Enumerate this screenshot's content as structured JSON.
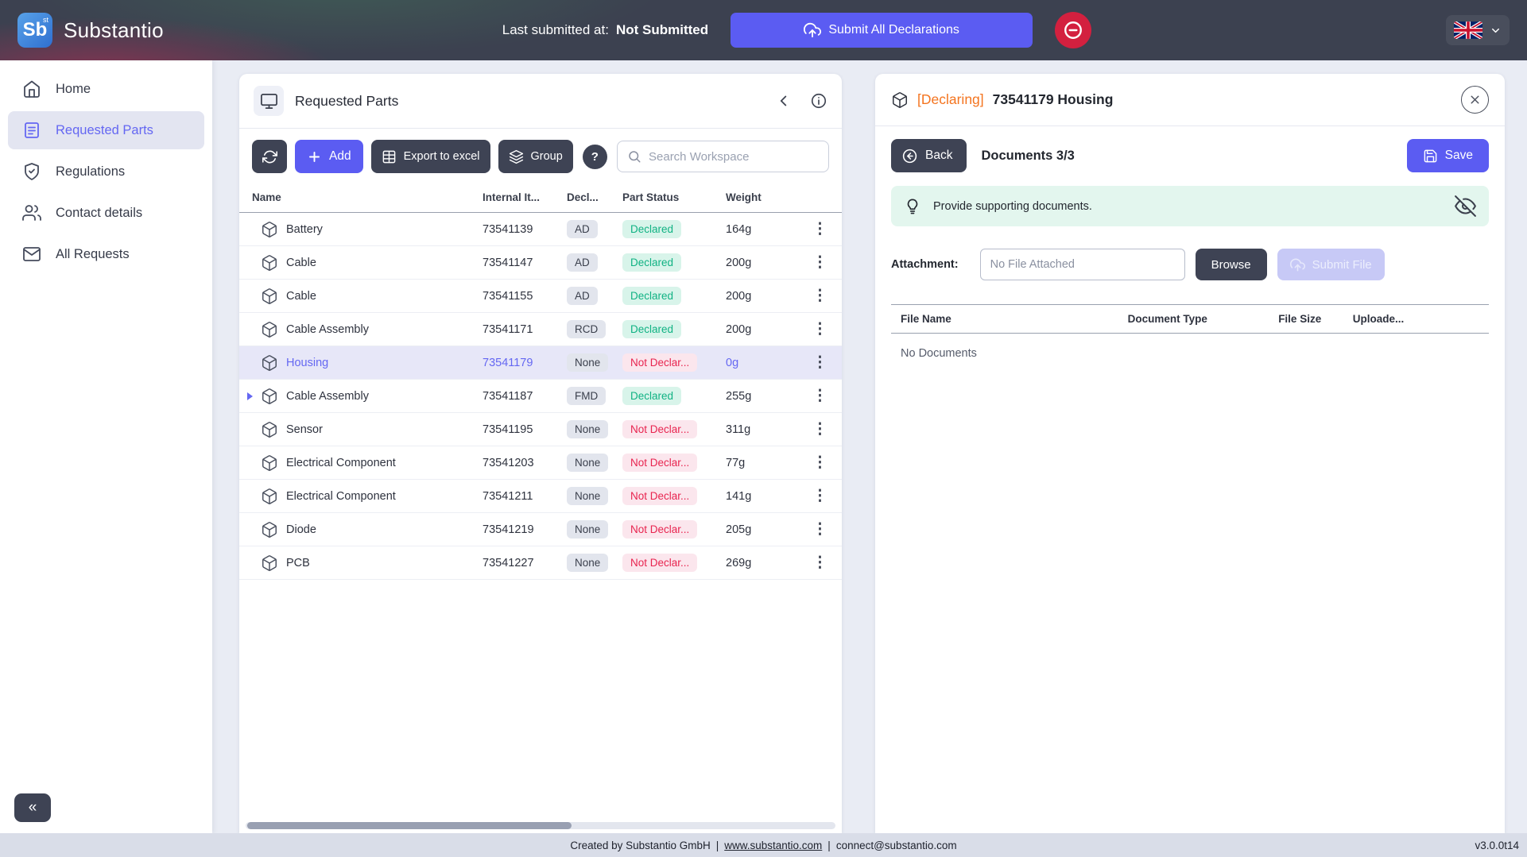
{
  "topbar": {
    "logo_text": "Sb",
    "logo_superscript": "st",
    "app_name": "Substantio",
    "last_submitted_label": "Last submitted at:",
    "last_submitted_value": "Not Submitted",
    "submit_all_label": "Submit All Declarations"
  },
  "sidebar": {
    "items": [
      {
        "label": "Home"
      },
      {
        "label": "Requested Parts"
      },
      {
        "label": "Regulations"
      },
      {
        "label": "Contact details"
      },
      {
        "label": "All Requests"
      }
    ],
    "collapse_label": "«"
  },
  "parts_panel": {
    "title": "Requested Parts",
    "toolbar": {
      "add_label": "Add",
      "export_label": "Export to excel",
      "group_label": "Group",
      "help_label": "?",
      "search_placeholder": "Search Workspace"
    },
    "table": {
      "columns": [
        "Name",
        "Internal It...",
        "Decl...",
        "Part Status",
        "Weight"
      ],
      "rows": [
        {
          "name": "Battery",
          "internal_item": "73541139",
          "decl": "AD",
          "status": "Declared",
          "status_type": "declared",
          "weight": "164g",
          "selected": false,
          "expandable": false
        },
        {
          "name": "Cable",
          "internal_item": "73541147",
          "decl": "AD",
          "status": "Declared",
          "status_type": "declared",
          "weight": "200g",
          "selected": false,
          "expandable": false
        },
        {
          "name": "Cable",
          "internal_item": "73541155",
          "decl": "AD",
          "status": "Declared",
          "status_type": "declared",
          "weight": "200g",
          "selected": false,
          "expandable": false
        },
        {
          "name": "Cable Assembly",
          "internal_item": "73541171",
          "decl": "RCD",
          "status": "Declared",
          "status_type": "declared",
          "weight": "200g",
          "selected": false,
          "expandable": false
        },
        {
          "name": "Housing",
          "internal_item": "73541179",
          "decl": "None",
          "status": "Not Declar...",
          "status_type": "not-declared",
          "weight": "0g",
          "selected": true,
          "expandable": false
        },
        {
          "name": "Cable Assembly",
          "internal_item": "73541187",
          "decl": "FMD",
          "status": "Declared",
          "status_type": "declared",
          "weight": "255g",
          "selected": false,
          "expandable": true
        },
        {
          "name": "Sensor",
          "internal_item": "73541195",
          "decl": "None",
          "status": "Not Declar...",
          "status_type": "not-declared",
          "weight": "311g",
          "selected": false,
          "expandable": false
        },
        {
          "name": "Electrical Component",
          "internal_item": "73541203",
          "decl": "None",
          "status": "Not Declar...",
          "status_type": "not-declared",
          "weight": "77g",
          "selected": false,
          "expandable": false
        },
        {
          "name": "Electrical Component",
          "internal_item": "73541211",
          "decl": "None",
          "status": "Not Declar...",
          "status_type": "not-declared",
          "weight": "141g",
          "selected": false,
          "expandable": false
        },
        {
          "name": "Diode",
          "internal_item": "73541219",
          "decl": "None",
          "status": "Not Declar...",
          "status_type": "not-declared",
          "weight": "205g",
          "selected": false,
          "expandable": false
        },
        {
          "name": "PCB",
          "internal_item": "73541227",
          "decl": "None",
          "status": "Not Declar...",
          "status_type": "not-declared",
          "weight": "269g",
          "selected": false,
          "expandable": false
        }
      ]
    }
  },
  "details_panel": {
    "declaring_tag": "[Declaring]",
    "title": "73541179 Housing",
    "back_label": "Back",
    "documents_label": "Documents 3/3",
    "save_label": "Save",
    "hint_text": "Provide supporting documents.",
    "attachment_label": "Attachment:",
    "attachment_placeholder": "No File Attached",
    "browse_label": "Browse",
    "submit_file_label": "Submit File",
    "columns": [
      "File Name",
      "Document Type",
      "File Size",
      "Uploade..."
    ],
    "empty_text": "No Documents"
  },
  "footer": {
    "created_by": "Created by Substantio GmbH",
    "separator": "|",
    "website": "www.substantio.com",
    "email": "connect@substantio.com",
    "version": "v3.0.0t14"
  },
  "colors": {
    "accent_purple": "#5b5cf2",
    "dark_button": "#3e4354",
    "declared_green": "#10b283",
    "not_declared_red": "#e8244f",
    "declaring_orange": "#f4741f",
    "stop_red": "#d3203f"
  }
}
